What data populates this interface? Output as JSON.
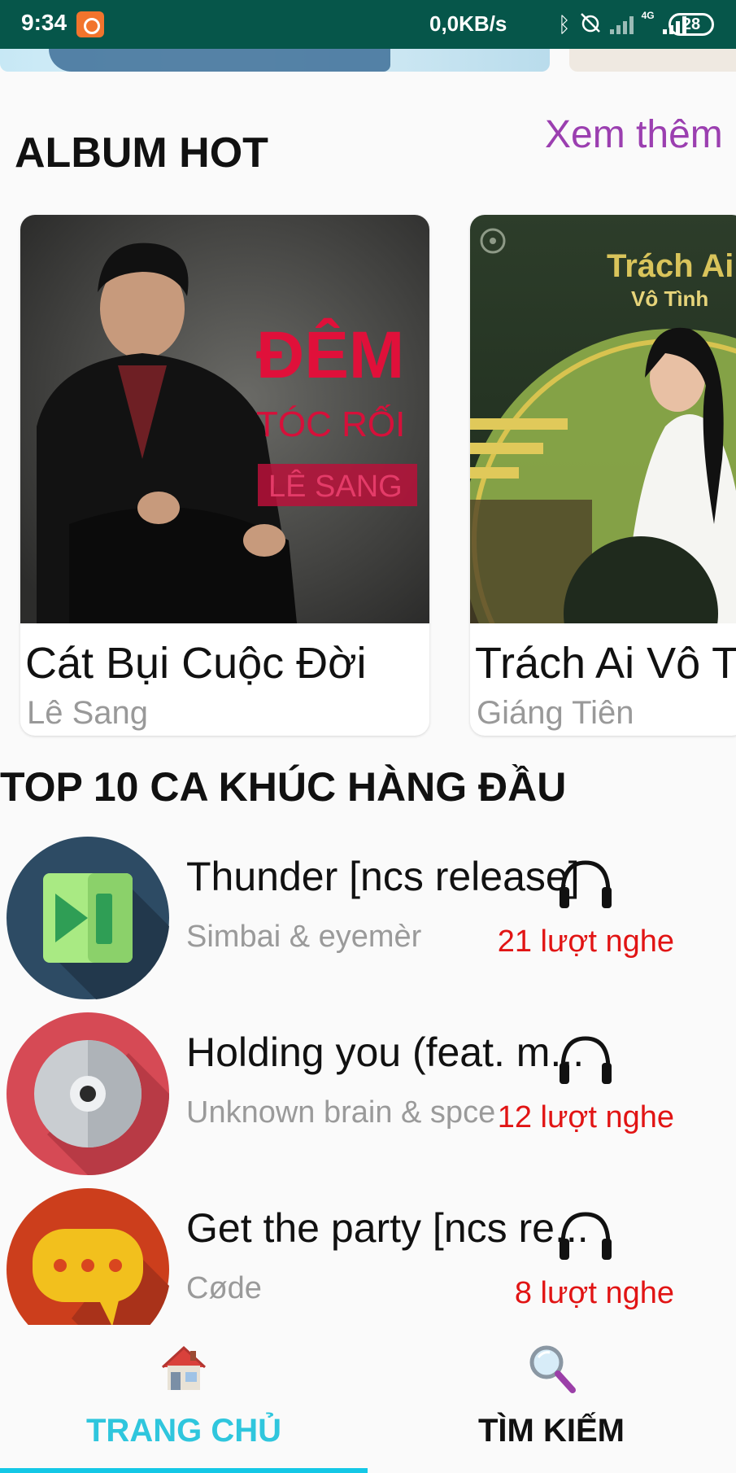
{
  "status_bar": {
    "time": "9:34",
    "network_speed": "0,0KB/s",
    "network_type": "4G",
    "battery": "28",
    "icons": [
      "mi-app-icon",
      "bluetooth-icon",
      "alarm-off-icon",
      "wifi-signal-icon",
      "cell-signal-icon",
      "battery-icon"
    ]
  },
  "album_section": {
    "title": "ALBUM HOT",
    "see_more": "Xem thêm",
    "albums": [
      {
        "name": "Cát Bụi Cuộc Đời",
        "artist": "Lê Sang",
        "cover_text": [
          "ĐÊM",
          "TÓC RỐI",
          "LÊ SANG"
        ]
      },
      {
        "name": "Trách Ai Vô Tình",
        "artist": "Giáng Tiên",
        "cover_text": [
          "Trách Ai",
          "Vô Tình"
        ]
      }
    ]
  },
  "top_section": {
    "title": "TOP 10 CA KHÚC HÀNG ĐẦU",
    "songs": [
      {
        "title": "Thunder [ncs release]",
        "artist": "Simbai & eyemèr",
        "plays": "21 lượt nghe",
        "icon": "media-next-icon"
      },
      {
        "title": "Holding you (feat. m...",
        "artist": "Unknown brain & spce",
        "plays": "12 lượt nghe",
        "icon": "cd-disc-icon"
      },
      {
        "title": "Get the party [ncs re...",
        "artist": "Cøde",
        "plays": "8 lượt nghe",
        "icon": "chat-bubble-icon"
      }
    ]
  },
  "bottom_nav": {
    "items": [
      {
        "label": "TRANG CHỦ",
        "icon": "home-icon",
        "active": true
      },
      {
        "label": "TÌM KIẾM",
        "icon": "search-icon",
        "active": false
      }
    ]
  },
  "colors": {
    "status_bar": "#06564a",
    "see_more": "#9b3fb0",
    "plays": "#e11414",
    "nav_active": "#2fc6dd"
  }
}
